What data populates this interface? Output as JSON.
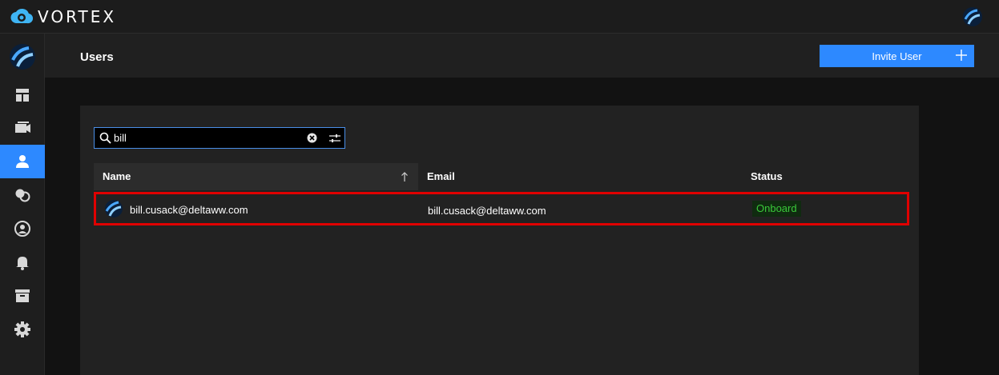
{
  "app": {
    "name": "VORTEX"
  },
  "header": {
    "title": "Users",
    "invite_label": "Invite User"
  },
  "search": {
    "value": "bill",
    "placeholder": ""
  },
  "table": {
    "columns": [
      "Name",
      "Email",
      "Status"
    ],
    "rows": [
      {
        "name": "bill.cusack@deltaww.com",
        "email": "bill.cusack@deltaww.com",
        "status": "Onboard"
      }
    ]
  },
  "sidebar": {
    "items": [
      {
        "icon": "dashboard-icon"
      },
      {
        "icon": "media-icon"
      },
      {
        "icon": "users-icon",
        "active": true
      },
      {
        "icon": "groups-icon"
      },
      {
        "icon": "profile-icon"
      },
      {
        "icon": "notifications-icon"
      },
      {
        "icon": "archive-icon"
      },
      {
        "icon": "settings-icon"
      }
    ]
  },
  "colors": {
    "accent": "#2d89ff",
    "highlight": "#e00000",
    "status_onboard": "#3ac93a"
  }
}
